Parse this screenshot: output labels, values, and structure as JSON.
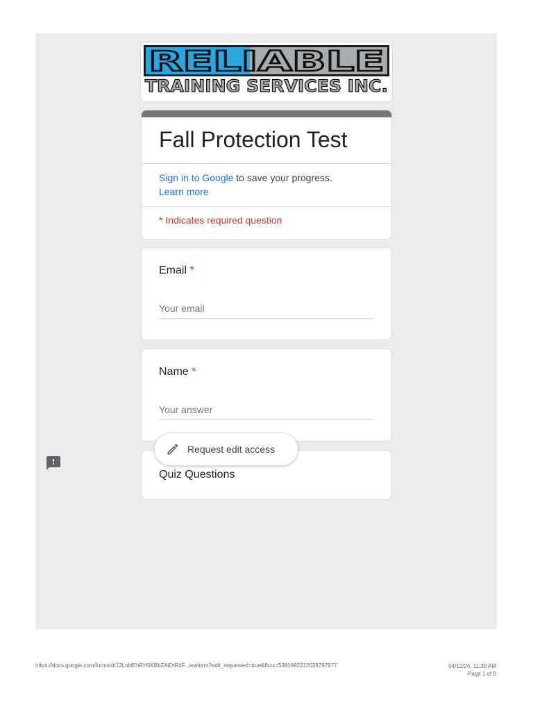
{
  "logo": {
    "line1": "RELIABLE",
    "line2": "TRAINING SERVICES INC.",
    "accent_color": "#2aa7e0"
  },
  "form": {
    "title": "Fall Protection Test",
    "signin_link": "Sign in to Google",
    "signin_suffix": " to save your progress.",
    "learn_more": "Learn more",
    "required_note": "* Indicates required question",
    "header_bar_color": "#757575"
  },
  "questions": [
    {
      "label": "Email",
      "required_mark": "*",
      "placeholder": "Your email"
    },
    {
      "label": "Name",
      "required_mark": "*",
      "placeholder": "Your answer"
    }
  ],
  "section": {
    "title": "Quiz Questions"
  },
  "edit_button": {
    "label": "Request edit access",
    "icon": "pencil-icon"
  },
  "feedback": {
    "icon": "report-icon"
  },
  "footer": {
    "url": "https://docs.google.com/forms/d/12LnblEhRH5KBbZAiDtR4F...iewform?edit_requested=true&fbzx=5381992212028797977",
    "datetime": "04/12/24, 11:30 AM",
    "page": "Page 1 of 9"
  }
}
